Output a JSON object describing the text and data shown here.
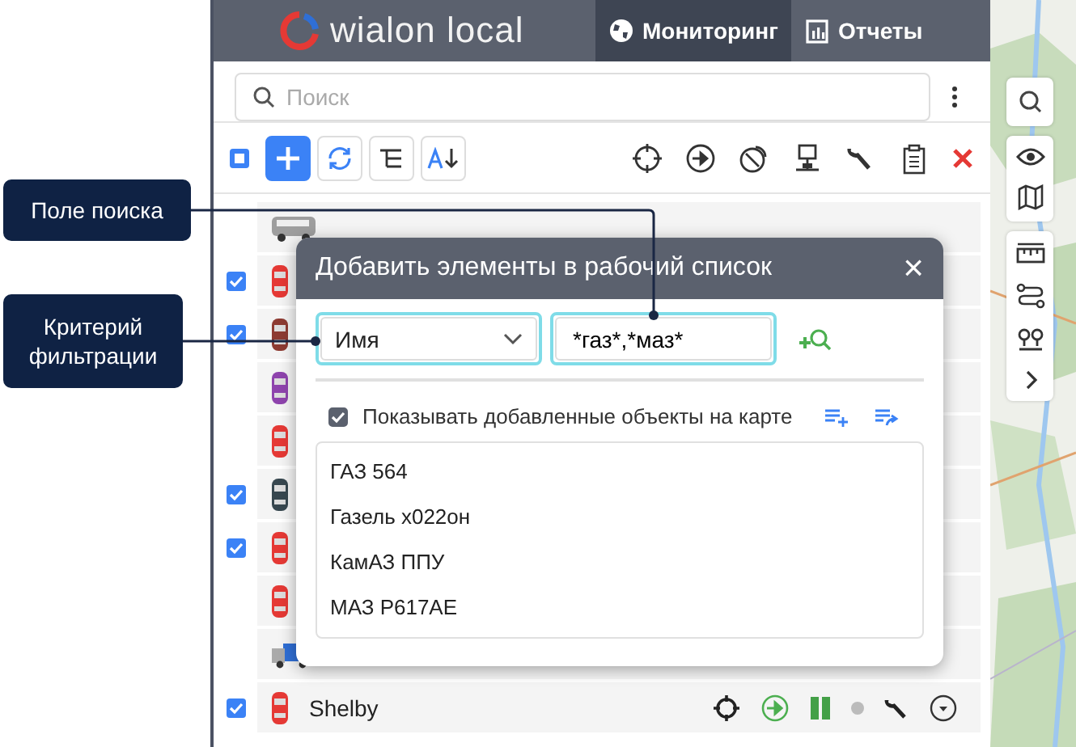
{
  "header": {
    "logo": "wialon local",
    "tabs": [
      {
        "label": "Мониторинг",
        "selected": true
      },
      {
        "label": "Отчеты",
        "selected": false
      }
    ]
  },
  "select_all": {
    "indeterminate": true
  },
  "search": {
    "placeholder": "Поиск"
  },
  "units": [
    {
      "kind": "van",
      "color": "#9e9e9e",
      "checked": false
    },
    {
      "kind": "car",
      "color": "#e53935",
      "checked": true
    },
    {
      "kind": "car",
      "color": "#8d3b32",
      "checked": true
    },
    {
      "kind": "car",
      "color": "#8e44ad",
      "checked": false
    },
    {
      "kind": "car",
      "color": "#e53935",
      "checked": false
    },
    {
      "kind": "car",
      "color": "#37474f",
      "checked": true
    },
    {
      "kind": "car",
      "color": "#e53935",
      "checked": true
    },
    {
      "kind": "car",
      "color": "#e53935",
      "checked": false
    },
    {
      "kind": "truck",
      "color": "#2f6fd6",
      "checked": false
    },
    {
      "kind": "car",
      "color": "#e53935",
      "checked": true,
      "name": "Shelby"
    }
  ],
  "dialog": {
    "title": "Добавить элементы в рабочий список",
    "close": "×",
    "filter": "Имя",
    "value": "*газ*,*маз*",
    "show_on_map": {
      "label": "Показывать добавленные объекты на карте",
      "checked": true
    },
    "results": [
      "ГАЗ 564",
      "Газель х022он",
      "КамАЗ ППУ",
      "МАЗ Р617АЕ"
    ]
  },
  "callouts": [
    {
      "text": "Поле поиска",
      "kind": "search"
    },
    {
      "text": "Критерий фильтрации",
      "kind": "filter"
    }
  ]
}
